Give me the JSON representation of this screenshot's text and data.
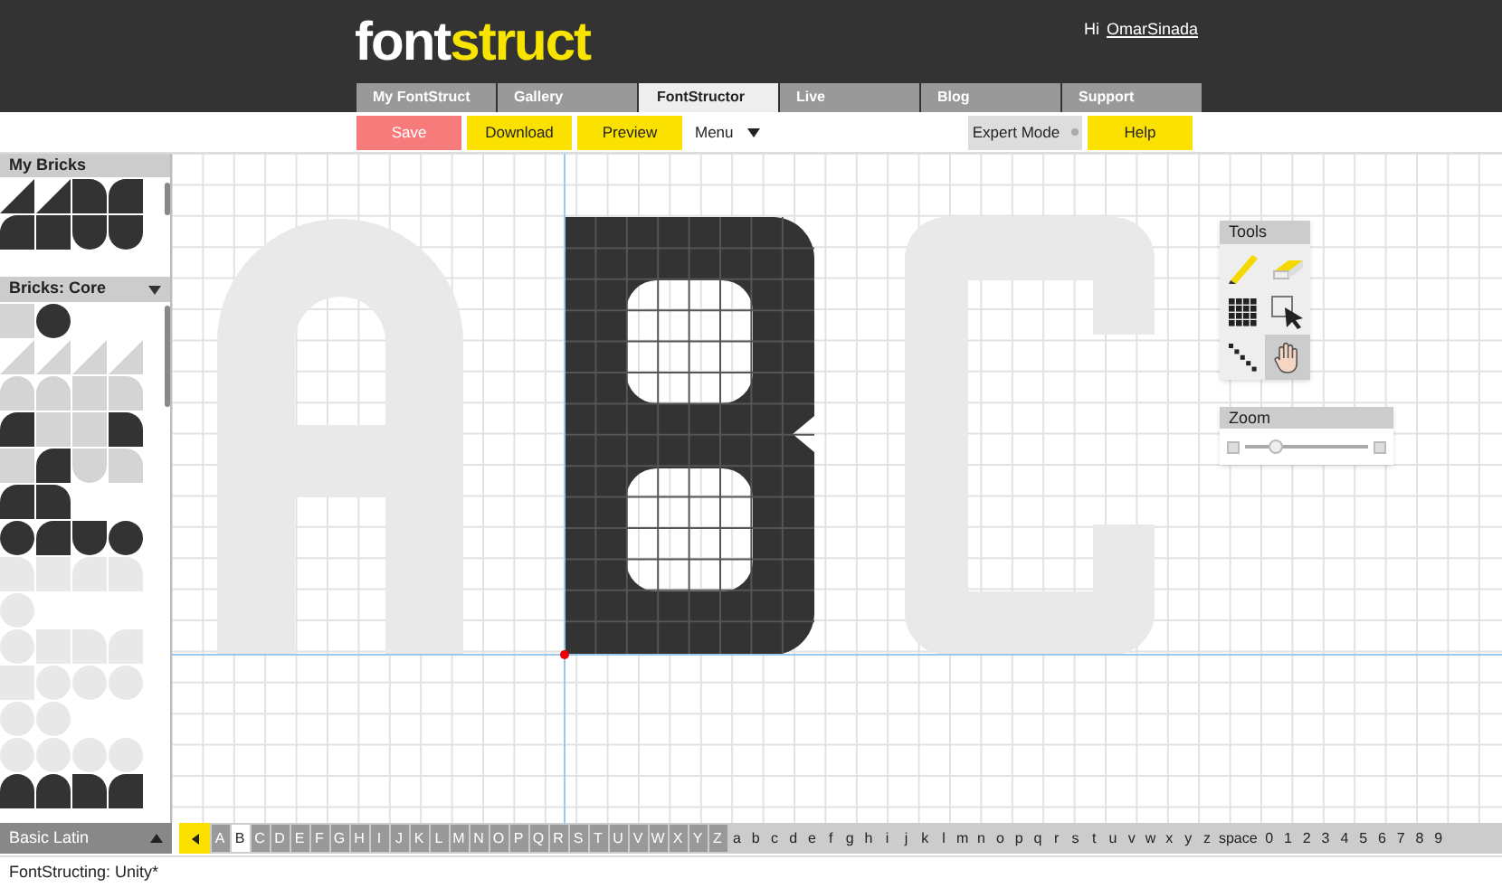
{
  "logo": {
    "part_1": "font",
    "part_2": "struct"
  },
  "user": {
    "greeting": "Hi",
    "name": "OmarSinada"
  },
  "tabs": [
    {
      "label": "My FontStruct",
      "selected": false
    },
    {
      "label": "Gallery",
      "selected": false
    },
    {
      "label": "FontStructor",
      "selected": true
    },
    {
      "label": "Live",
      "selected": false
    },
    {
      "label": "Blog",
      "selected": false
    },
    {
      "label": "Support",
      "selected": false
    }
  ],
  "toolbar": {
    "save": "Save",
    "download": "Download",
    "preview": "Preview",
    "menu": "Menu",
    "expert_mode": {
      "label": "Expert Mode",
      "on": false
    },
    "help": "Help"
  },
  "sidebar": {
    "my_bricks": {
      "title": "My Bricks"
    },
    "core_bricks": {
      "title": "Bricks: Core",
      "expanded": true
    },
    "charset": {
      "label": "Basic Latin"
    }
  },
  "tools": {
    "title": "Tools",
    "items": [
      {
        "kind": "pencil",
        "selected": false
      },
      {
        "kind": "eraser",
        "selected": false
      },
      {
        "kind": "fill",
        "selected": false
      },
      {
        "kind": "select",
        "selected": false
      },
      {
        "kind": "line",
        "selected": false
      },
      {
        "kind": "hand",
        "selected": true
      }
    ]
  },
  "zoom": {
    "title": "Zoom",
    "level": 0.25
  },
  "glyphs": [
    {
      "char": "A",
      "defined": true,
      "selected": false
    },
    {
      "char": "B",
      "defined": true,
      "selected": true
    },
    {
      "char": "C",
      "defined": true,
      "selected": false
    },
    {
      "char": "D",
      "defined": true,
      "selected": false
    },
    {
      "char": "E",
      "defined": true,
      "selected": false
    },
    {
      "char": "F",
      "defined": true,
      "selected": false
    },
    {
      "char": "G",
      "defined": true,
      "selected": false
    },
    {
      "char": "H",
      "defined": true,
      "selected": false
    },
    {
      "char": "I",
      "defined": true,
      "selected": false
    },
    {
      "char": "J",
      "defined": true,
      "selected": false
    },
    {
      "char": "K",
      "defined": true,
      "selected": false
    },
    {
      "char": "L",
      "defined": true,
      "selected": false
    },
    {
      "char": "M",
      "defined": true,
      "selected": false
    },
    {
      "char": "N",
      "defined": true,
      "selected": false
    },
    {
      "char": "O",
      "defined": true,
      "selected": false
    },
    {
      "char": "P",
      "defined": true,
      "selected": false
    },
    {
      "char": "Q",
      "defined": true,
      "selected": false
    },
    {
      "char": "R",
      "defined": true,
      "selected": false
    },
    {
      "char": "S",
      "defined": true,
      "selected": false
    },
    {
      "char": "T",
      "defined": true,
      "selected": false
    },
    {
      "char": "U",
      "defined": true,
      "selected": false
    },
    {
      "char": "V",
      "defined": true,
      "selected": false
    },
    {
      "char": "W",
      "defined": true,
      "selected": false
    },
    {
      "char": "X",
      "defined": true,
      "selected": false
    },
    {
      "char": "Y",
      "defined": true,
      "selected": false
    },
    {
      "char": "Z",
      "defined": true,
      "selected": false
    },
    {
      "char": "a",
      "defined": false,
      "selected": false
    },
    {
      "char": "b",
      "defined": false,
      "selected": false
    },
    {
      "char": "c",
      "defined": false,
      "selected": false
    },
    {
      "char": "d",
      "defined": false,
      "selected": false
    },
    {
      "char": "e",
      "defined": false,
      "selected": false
    },
    {
      "char": "f",
      "defined": false,
      "selected": false
    },
    {
      "char": "g",
      "defined": false,
      "selected": false
    },
    {
      "char": "h",
      "defined": false,
      "selected": false
    },
    {
      "char": "i",
      "defined": false,
      "selected": false
    },
    {
      "char": "j",
      "defined": false,
      "selected": false
    },
    {
      "char": "k",
      "defined": false,
      "selected": false
    },
    {
      "char": "l",
      "defined": false,
      "selected": false
    },
    {
      "char": "m",
      "defined": false,
      "selected": false
    },
    {
      "char": "n",
      "defined": false,
      "selected": false
    },
    {
      "char": "o",
      "defined": false,
      "selected": false
    },
    {
      "char": "p",
      "defined": false,
      "selected": false
    },
    {
      "char": "q",
      "defined": false,
      "selected": false
    },
    {
      "char": "r",
      "defined": false,
      "selected": false
    },
    {
      "char": "s",
      "defined": false,
      "selected": false
    },
    {
      "char": "t",
      "defined": false,
      "selected": false
    },
    {
      "char": "u",
      "defined": false,
      "selected": false
    },
    {
      "char": "v",
      "defined": false,
      "selected": false
    },
    {
      "char": "w",
      "defined": false,
      "selected": false
    },
    {
      "char": "x",
      "defined": false,
      "selected": false
    },
    {
      "char": "y",
      "defined": false,
      "selected": false
    },
    {
      "char": "z",
      "defined": false,
      "selected": false
    },
    {
      "char": "space",
      "defined": false,
      "selected": false
    },
    {
      "char": "0",
      "defined": false,
      "selected": false
    },
    {
      "char": "1",
      "defined": false,
      "selected": false
    },
    {
      "char": "2",
      "defined": false,
      "selected": false
    },
    {
      "char": "3",
      "defined": false,
      "selected": false
    },
    {
      "char": "4",
      "defined": false,
      "selected": false
    },
    {
      "char": "5",
      "defined": false,
      "selected": false
    },
    {
      "char": "6",
      "defined": false,
      "selected": false
    },
    {
      "char": "7",
      "defined": false,
      "selected": false
    },
    {
      "char": "8",
      "defined": false,
      "selected": false
    },
    {
      "char": "9",
      "defined": false,
      "selected": false
    }
  ],
  "status_bar": "FontStructing: Unity*"
}
